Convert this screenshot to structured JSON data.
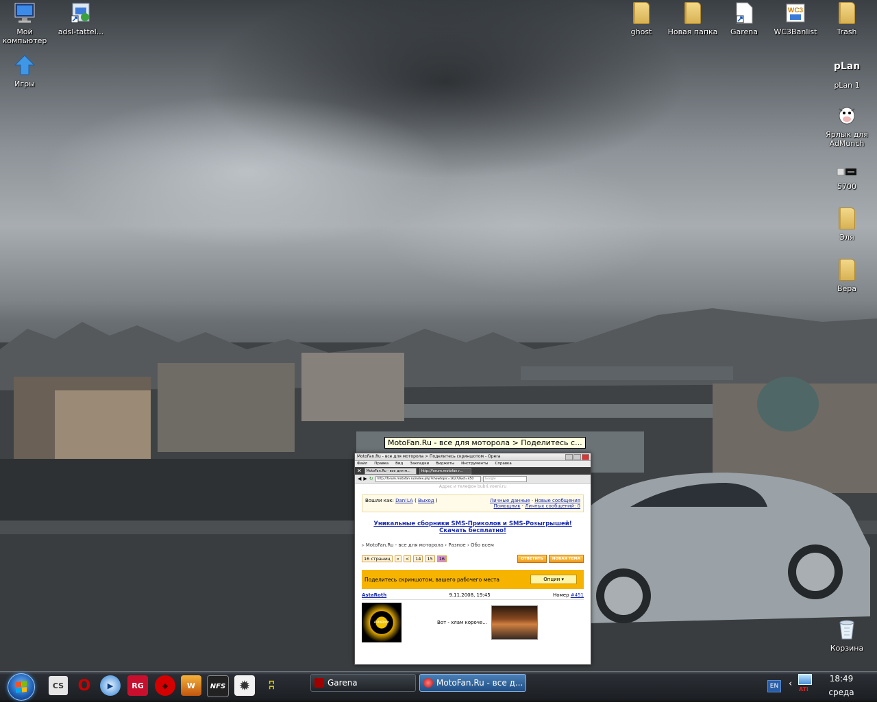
{
  "desktop_icons_left": [
    {
      "name": "my-computer",
      "label": "Мой компьютер",
      "icon": "monitor-icon"
    },
    {
      "name": "adsl",
      "label": "adsl-tattel...",
      "icon": "shortcut-icon"
    },
    {
      "name": "games",
      "label": "Игры",
      "icon": "up-arrow-icon"
    }
  ],
  "desktop_icons_right": [
    {
      "name": "ghost",
      "label": "ghost",
      "icon": "folder-icon"
    },
    {
      "name": "new-folder",
      "label": "Новая папка",
      "icon": "folder-icon"
    },
    {
      "name": "garena",
      "label": "Garena",
      "icon": "file-shortcut-icon"
    },
    {
      "name": "wc3banlist",
      "label": "WC3Banlist",
      "icon": "wc3-icon"
    },
    {
      "name": "trash",
      "label": "Trash",
      "icon": "folder-icon"
    },
    {
      "name": "plan1",
      "label": "pLan 1",
      "icon_text": "pLan"
    },
    {
      "name": "admunch",
      "label": "Ярлык для AdMunch",
      "icon": "cow-icon"
    },
    {
      "name": "5700",
      "label": "5700",
      "icon": "device-icon"
    },
    {
      "name": "elya",
      "label": "Эля",
      "icon": "folder-icon"
    },
    {
      "name": "vera",
      "label": "Вера",
      "icon": "folder-icon"
    },
    {
      "name": "recycle-bin",
      "label": "Корзина",
      "icon": "recycle-bin-icon"
    }
  ],
  "tooltip": "MotoFan.Ru - все для моторола > Поделитесь с...",
  "preview": {
    "title": "MotoFan.Ru - все для моторола > Поделитесь скриншотом - Opera",
    "menu": [
      "Файл",
      "Правка",
      "Вид",
      "Закладки",
      "Виджеты",
      "Инструменты",
      "Справка"
    ],
    "tabs": [
      "MotoFan.Ru - все для м...",
      "http://forum.motofan.r..."
    ],
    "url": "http://forum.motofan.ru/index.php?showtopic=16272&st=450",
    "search_placeholder": "Google",
    "top_hint": "Адрес и телефон   bubri.voeni.ru",
    "login_prefix": "Вошли как:",
    "login_user": "Dan!LA",
    "logout": "Выход",
    "personal": "Личные данные",
    "new_messages": "Новые сообщения",
    "helper": "Помощник",
    "pm": "Личных сообщений: 0",
    "banner": "Уникальные сборники SMS-Приколов и SMS-Розыгрышей! Скачать бесплатно!",
    "breadcrumbs": [
      "MotoFan.Ru - все для моторола",
      "Разное",
      "Обо всем"
    ],
    "pages_label": "16 страниц",
    "pages": [
      "«",
      "<",
      "14",
      "15",
      "16"
    ],
    "reply_btn": "ОТВЕТИТЬ",
    "newtopic_btn": "НОВАЯ ТЕМА",
    "topic_title": "Поделитесь скриншотом, вашего рабочего места",
    "options_btn": "Опции ▾",
    "post_author": "AstaRoth",
    "post_date": "9.11.2008, 19:45",
    "post_num_label": "Номер",
    "post_num": "#451",
    "post_text": "Вот - хлам короче...",
    "avatar_text": "AstaRoth"
  },
  "taskbar": {
    "quicklaunch": [
      {
        "name": "counter-strike-icon",
        "color": "#5a5a5a",
        "glyph": "CS"
      },
      {
        "name": "opera-icon",
        "color": "#b00000",
        "glyph": "O"
      },
      {
        "name": "media-player-icon",
        "color": "#2a7fd4",
        "glyph": "▶"
      },
      {
        "name": "rg-icon",
        "color": "#c8102e",
        "glyph": "RG"
      },
      {
        "name": "red-diamond-icon",
        "color": "#d40000",
        "glyph": "◆"
      },
      {
        "name": "warcraft-icon",
        "color": "#d07a10",
        "glyph": "W"
      },
      {
        "name": "nfs-icon",
        "color": "#333333",
        "glyph": "NFS"
      },
      {
        "name": "settings-gear-icon",
        "color": "#ededed",
        "glyph": "✹"
      },
      {
        "name": "yellow-app-icon",
        "color": "#c9b400",
        "glyph": "ʭ"
      }
    ],
    "tasks": [
      {
        "name": "task-garena",
        "label": "Garena",
        "icon_color": "#a00000"
      },
      {
        "name": "task-motofan",
        "label": "MotoFan.Ru - все д...",
        "icon_color": "#d02020"
      }
    ],
    "lang": "EN",
    "clock_time": "18:49",
    "clock_day": "среда"
  }
}
